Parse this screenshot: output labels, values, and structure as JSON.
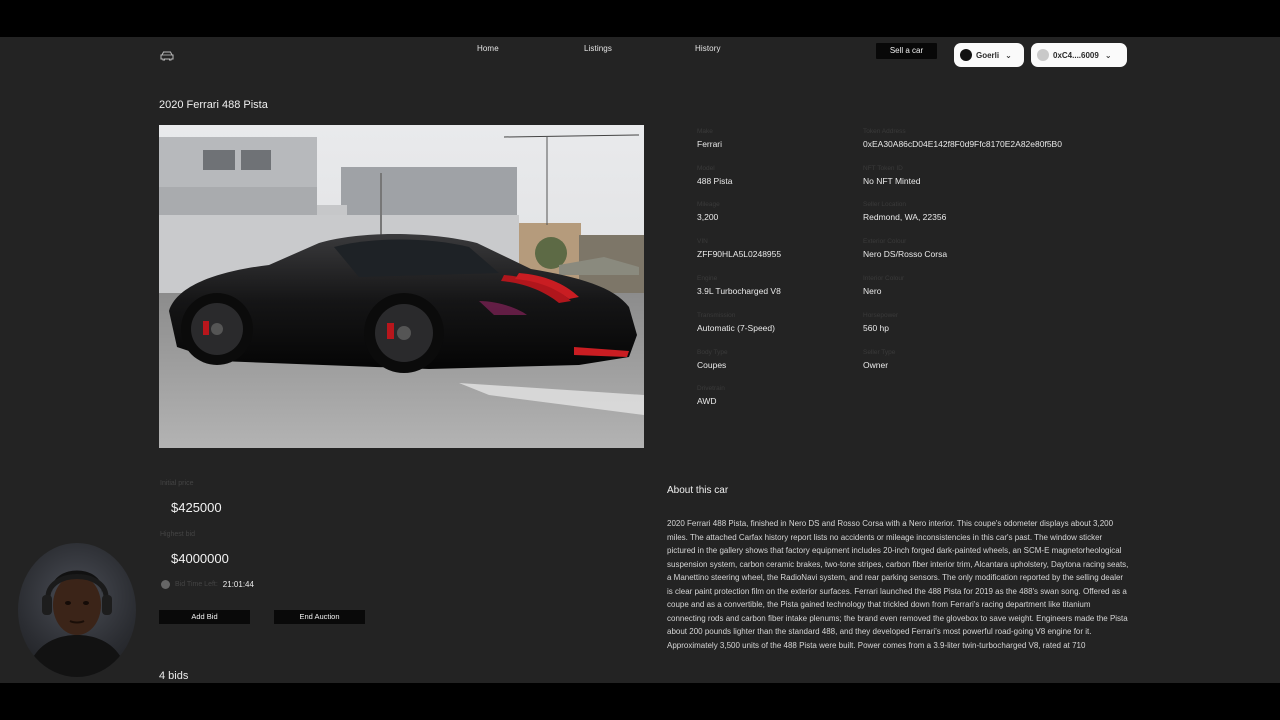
{
  "nav": {
    "links": [
      "Home",
      "Listings",
      "History"
    ],
    "sell_label": "Sell a car",
    "network_label": "Goerli",
    "account_label": "0xC4....6009"
  },
  "listing": {
    "title": "2020 Ferrari 488 Pista",
    "specs": [
      {
        "label": "Make",
        "value": "Ferrari"
      },
      {
        "label": "Token Address",
        "value": "0xEA30A86cD04E142f8F0d9Ffc8170E2A82e80f5B0"
      },
      {
        "label": "Model",
        "value": "488 Pista"
      },
      {
        "label": "NFT Token ID",
        "value": "No NFT Minted"
      },
      {
        "label": "Mileage",
        "value": "3,200"
      },
      {
        "label": "Seller Location",
        "value": "Redmond, WA, 22356"
      },
      {
        "label": "VIN",
        "value": "ZFF90HLA5L0248955"
      },
      {
        "label": "Exterior Colour",
        "value": "Nero DS/Rosso Corsa"
      },
      {
        "label": "Engine",
        "value": "3.9L Turbocharged V8"
      },
      {
        "label": "Interior Colour",
        "value": "Nero"
      },
      {
        "label": "Transmission",
        "value": "Automatic (7-Speed)"
      },
      {
        "label": "Horsepower",
        "value": "560 hp"
      },
      {
        "label": "Body Type",
        "value": "Coupes"
      },
      {
        "label": "Seller Type",
        "value": "Owner"
      },
      {
        "label": "Drivetrain",
        "value": "AWD"
      }
    ]
  },
  "auction": {
    "initial_price_label": "Initial price",
    "initial_price": "$425000",
    "highest_bid_label": "Highest bid",
    "highest_bid": "$4000000",
    "time_left_label": "Bid Time Left:",
    "time_left": "21:01:44",
    "add_bid_label": "Add Bid",
    "end_auction_label": "End Auction",
    "bids_count": "4 bids"
  },
  "about": {
    "title": "About this car",
    "text": "2020 Ferrari 488 Pista, finished in Nero DS and Rosso Corsa with a Nero interior. This coupe's odometer displays about 3,200 miles. The attached Carfax history report lists no accidents or mileage inconsistencies in this car's past. The window sticker pictured in the gallery shows that factory equipment includes 20-inch forged dark-painted wheels, an SCM-E magnetorheological suspension system, carbon ceramic brakes, two-tone stripes, carbon fiber interior trim, Alcantara upholstery, Daytona racing seats, a Manettino steering wheel, the RadioNavi system, and rear parking sensors. The only modification reported by the selling dealer is clear paint protection film on the exterior surfaces. Ferrari launched the 488 Pista for 2019 as the 488's swan song. Offered as a coupe and as a convertible, the Pista gained technology that trickled down from Ferrari's racing department like titanium connecting rods and carbon fiber intake plenums; the brand even removed the glovebox to save weight. Engineers made the Pista about 200 pounds lighter than the standard 488, and they developed Ferrari's most powerful road-going V8 engine for it. Approximately 3,500 units of the 488 Pista were built. Power comes from a 3.9-liter twin-turbocharged V8, rated at 710"
  }
}
